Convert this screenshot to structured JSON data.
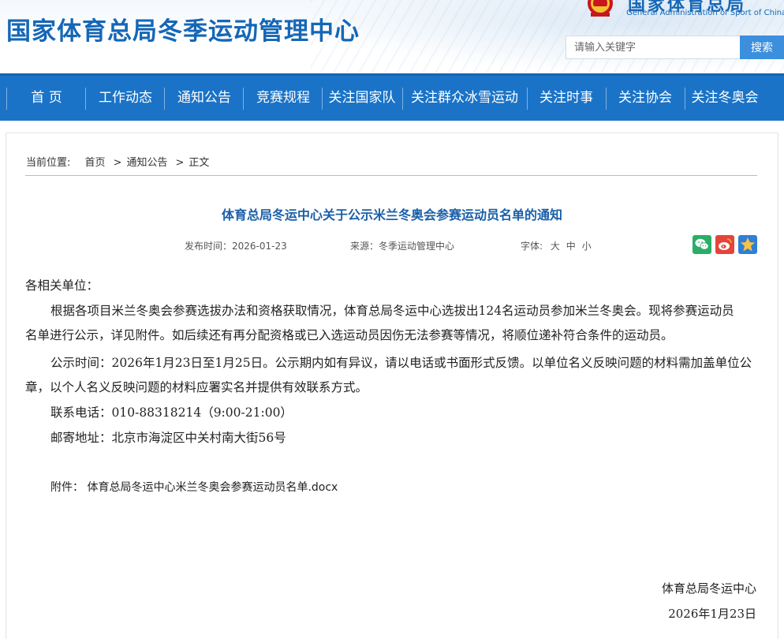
{
  "header": {
    "site_title": "国家体育总局冬季运动管理中心",
    "org_name_cn": "国家体育总局",
    "org_name_en": "General Administration of Sport of China",
    "search_placeholder": "请输入关键字",
    "search_button": "搜索"
  },
  "nav": {
    "items": [
      "首 页",
      "工作动态",
      "通知公告",
      "竞赛规程",
      "关注国家队",
      "关注群众冰雪运动",
      "关注时事",
      "关注协会",
      "关注冬奥会"
    ]
  },
  "breadcrumb": {
    "prefix": "当前位置:",
    "items": [
      "首页",
      "通知公告",
      "正文"
    ],
    "separator": ">"
  },
  "article": {
    "title": "体育总局冬运中心关于公示米兰冬奥会参赛运动员名单的通知",
    "publish_time": "发布时间：2026-01-23",
    "source": "来源：冬季运动管理中心",
    "font_size_label": "字体:",
    "font_sizes": [
      "大",
      "中",
      "小"
    ],
    "salutation": "各相关单位：",
    "paragraph1_line1": "根据各项目米兰冬奥会参赛选拔办法和资格获取情况，体育总局冬运中心选拔出124名运动员参加米兰冬奥会。现将参赛运动员",
    "paragraph1_line2": "名单进行公示，详见附件。如后续还有再分配资格或已入选运动员因伤无法参赛等情况，将顺位递补符合条件的运动员。",
    "paragraph2_line1": "公示时间：2026年1月23日至1月25日。公示期内如有异议，请以电话或书面形式反馈。以单位名义反映问题的材料需加盖单位公",
    "paragraph2_line2": "章，以个人名义反映问题的材料应署实名并提供有效联系方式。",
    "phone": "联系电话：010-88318214（9:00-21:00）",
    "address": "邮寄地址：北京市海淀区中关村南大街56号",
    "attachment_label": "附件：",
    "attachment_file": "体育总局冬运中心米兰冬奥会参赛运动员名单.docx",
    "signature_org": "体育总局冬运中心",
    "signature_date": "2026年1月23日"
  },
  "share": {
    "icons": [
      "wechat-icon",
      "weibo-icon",
      "favorite-icon"
    ]
  },
  "colors": {
    "brand_blue": "#1567b6",
    "nav_blue": "#1a73c7",
    "title_blue": "#1a5fa8",
    "search_button": "#3c8fdd"
  }
}
